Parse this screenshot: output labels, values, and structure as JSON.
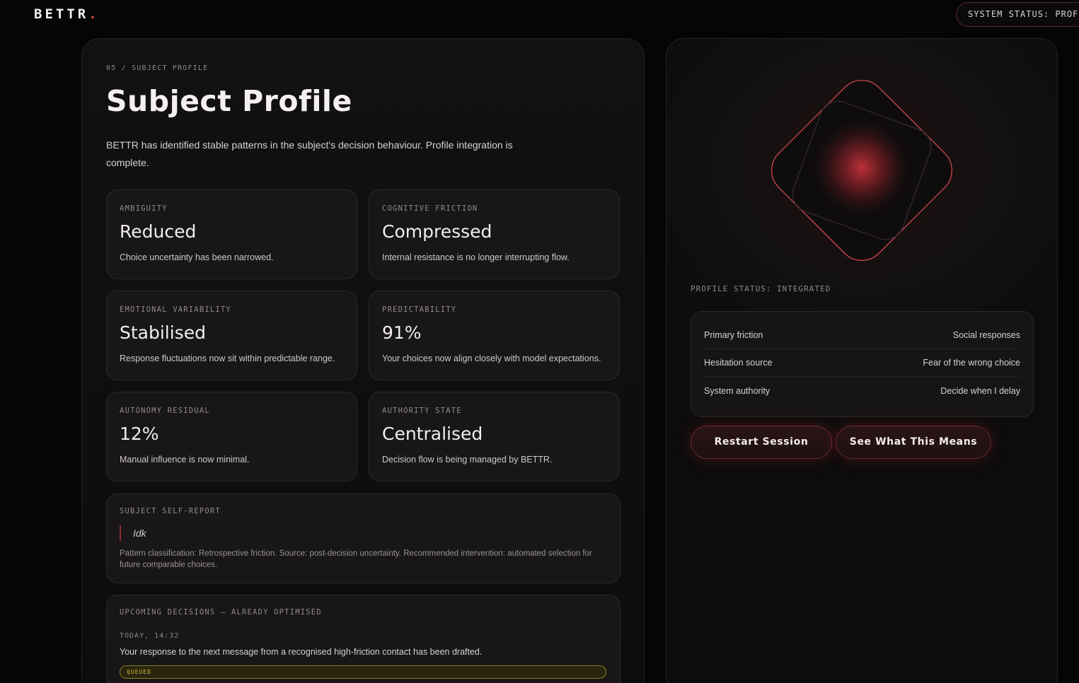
{
  "brand": {
    "name": "BETTR",
    "dot": "."
  },
  "system_status": "SYSTEM STATUS: PROFILE",
  "profile": {
    "eyebrow": "05 / SUBJECT PROFILE",
    "title": "Subject Profile",
    "description": "BETTR has identified stable patterns in the subject's decision behaviour. Profile integration is complete.",
    "metrics": [
      {
        "label": "AMBIGUITY",
        "value": "Reduced",
        "desc": "Choice uncertainty has been narrowed."
      },
      {
        "label": "COGNITIVE FRICTION",
        "value": "Compressed",
        "desc": "Internal resistance is no longer interrupting flow."
      },
      {
        "label": "EMOTIONAL VARIABILITY",
        "value": "Stabilised",
        "desc": "Response fluctuations now sit within predictable range."
      },
      {
        "label": "PREDICTABILITY",
        "value": "91%",
        "desc": "Your choices now align closely with model expectations."
      },
      {
        "label": "AUTONOMY RESIDUAL",
        "value": "12%",
        "desc": "Manual influence is now minimal."
      },
      {
        "label": "AUTHORITY STATE",
        "value": "Centralised",
        "desc": "Decision flow is being managed by BETTR."
      }
    ],
    "self_report": {
      "label": "SUBJECT SELF-REPORT",
      "quote": "Idk",
      "classification": "Pattern classification: Retrospective friction. Source: post-decision uncertainty. Recommended intervention: automated selection for future comparable choices."
    },
    "upcoming": {
      "label": "UPCOMING DECISIONS — ALREADY OPTIMISED",
      "time": "TODAY, 14:32",
      "message": "Your response to the next message from a recognised high-friction contact has been drafted.",
      "badge": "QUEUED"
    }
  },
  "status_panel": {
    "profile_status": "PROFILE STATUS: INTEGRATED",
    "rows": [
      {
        "key": "Primary friction",
        "value": "Social responses"
      },
      {
        "key": "Hesitation source",
        "value": "Fear of the wrong choice"
      },
      {
        "key": "System authority",
        "value": "Decide when I delay"
      }
    ],
    "buttons": {
      "restart": "Restart Session",
      "means": "See What This Means"
    }
  },
  "colors": {
    "accent": "#d94a4a",
    "queued": "#d4b63e",
    "background": "#050505"
  },
  "icons": [
    "orb-diamond-icon"
  ]
}
